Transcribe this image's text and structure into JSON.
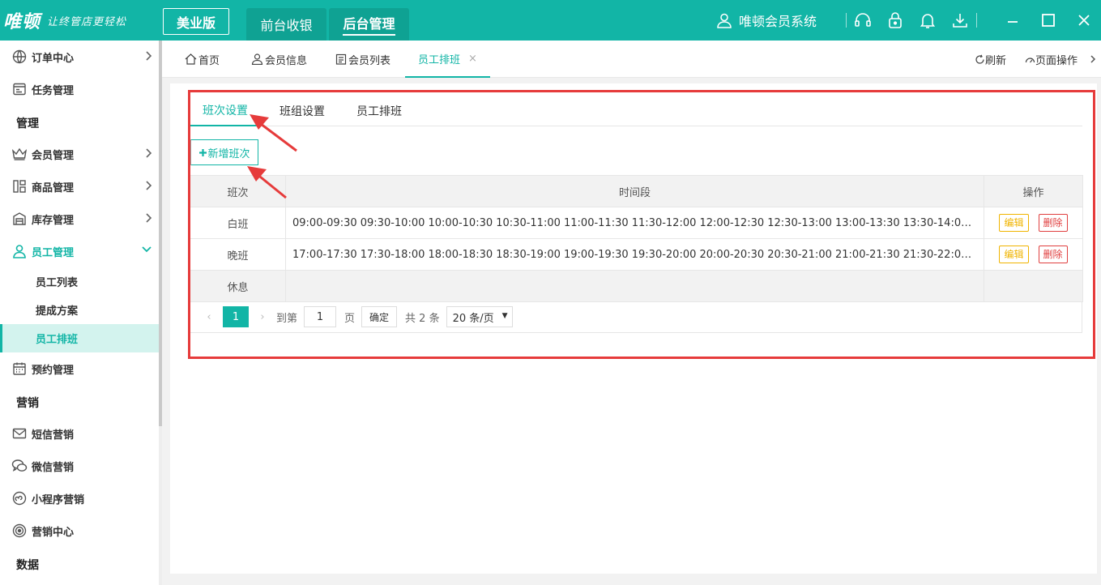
{
  "app": {
    "brand": "唯顿",
    "slogan": "让终管店更轻松",
    "edition": "美业版",
    "top_tabs": [
      "前台收银",
      "后台管理"
    ],
    "system_name": "唯顿会员系统",
    "accent": "#12b5a6"
  },
  "sidebar": {
    "items": [
      {
        "label": "订单中心",
        "icon": "globe-icon"
      },
      {
        "label": "任务管理",
        "icon": "task-icon"
      },
      {
        "label": "管理",
        "group": true
      },
      {
        "label": "会员管理",
        "icon": "crown-icon"
      },
      {
        "label": "商品管理",
        "icon": "grid-icon"
      },
      {
        "label": "库存管理",
        "icon": "warehouse-icon"
      },
      {
        "label": "员工管理",
        "icon": "user-icon",
        "active": true
      },
      {
        "label": "员工列表",
        "sub": true
      },
      {
        "label": "提成方案",
        "sub": true
      },
      {
        "label": "员工排班",
        "sub": true,
        "current": true
      },
      {
        "label": "预约管理",
        "icon": "calendar-icon"
      },
      {
        "label": "营销",
        "group": true
      },
      {
        "label": "短信营销",
        "icon": "mail-icon"
      },
      {
        "label": "微信营销",
        "icon": "wechat-icon"
      },
      {
        "label": "小程序营销",
        "icon": "miniprogram-icon"
      },
      {
        "label": "营销中心",
        "icon": "target-icon"
      },
      {
        "label": "数据",
        "group": true
      }
    ]
  },
  "page_tabs": {
    "tabs": [
      "首页",
      "会员信息",
      "会员列表",
      "员工排班"
    ],
    "close": "×",
    "refresh": "刷新",
    "page_ops": "页面操作"
  },
  "sub_tabs": [
    "班次设置",
    "班组设置",
    "员工排班"
  ],
  "add_button": "新增班次",
  "table": {
    "headers": [
      "班次",
      "时间段",
      "操作"
    ],
    "rows": [
      {
        "name": "白班",
        "periods": "09:00-09:30 09:30-10:00 10:00-10:30 10:30-11:00 11:00-11:30 11:30-12:00 12:00-12:30 12:30-13:00 13:00-13:30 13:30-14:00 14:00..."
      },
      {
        "name": "晚班",
        "periods": "17:00-17:30 17:30-18:00 18:00-18:30 18:30-19:00 19:00-19:30 19:30-20:00 20:00-20:30 20:30-21:00 21:00-21:30 21:30-22:00 22:00..."
      },
      {
        "name": "休息",
        "periods": ""
      }
    ],
    "edit_label": "编辑",
    "delete_label": "删除"
  },
  "pager": {
    "prev": "‹",
    "current": "1",
    "next": "›",
    "goto_label": "到第",
    "goto_value": "1",
    "page_unit": "页",
    "confirm": "确定",
    "total": "共 2 条",
    "page_size": "20 条/页"
  }
}
